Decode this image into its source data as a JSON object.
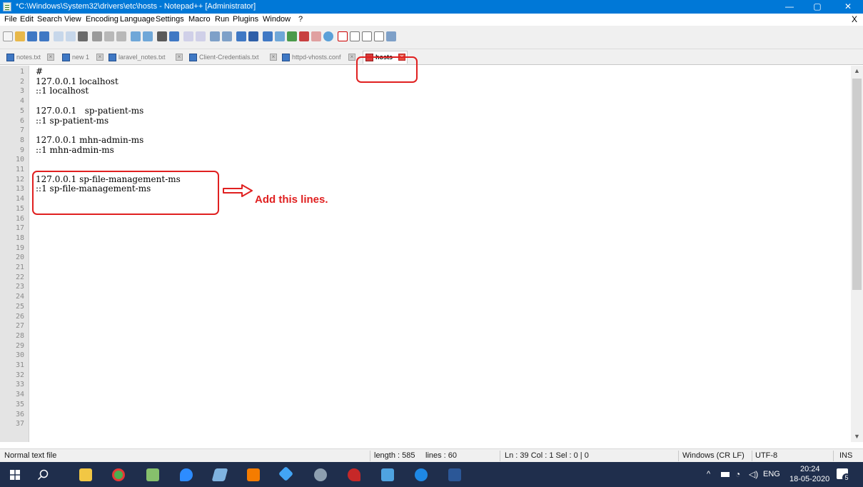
{
  "window": {
    "title": "*C:\\Windows\\System32\\drivers\\etc\\hosts - Notepad++ [Administrator]",
    "minimize": "—",
    "maximize": "▢",
    "close": "✕"
  },
  "menu": {
    "items": [
      "File",
      "Edit",
      "Search",
      "View",
      "Encoding",
      "Language",
      "Settings",
      "Macro",
      "Run",
      "Plugins",
      "Window",
      "?"
    ],
    "close_doc": "X"
  },
  "tabs": [
    {
      "label": "notes.txt",
      "active": false
    },
    {
      "label": "new 1",
      "active": false
    },
    {
      "label": "laravel_notes.txt",
      "active": false
    },
    {
      "label": "Client-Credentials.txt",
      "active": false
    },
    {
      "label": "httpd-vhosts.conf",
      "active": false
    },
    {
      "label": "hosts",
      "active": true
    }
  ],
  "editor": {
    "line_numbers": [
      "1",
      "2",
      "3",
      "4",
      "5",
      "6",
      "7",
      "8",
      "9",
      "10",
      "11",
      "12",
      "13",
      "14",
      "15",
      "16",
      "17",
      "18",
      "19",
      "20",
      "21",
      "22",
      "23",
      "24",
      "25",
      "26",
      "27",
      "28",
      "29",
      "30",
      "31",
      "32",
      "33",
      "34",
      "35",
      "36",
      "37"
    ],
    "lines": [
      "#",
      "127.0.0.1 localhost",
      "::1 localhost",
      "",
      "127.0.0.1   sp-patient-ms",
      "::1 sp-patient-ms",
      "",
      "127.0.0.1 mhn-admin-ms",
      "::1 mhn-admin-ms",
      "",
      "",
      "127.0.0.1 sp-file-management-ms",
      "::1 sp-file-management-ms"
    ]
  },
  "annotation": {
    "text": "Add this lines.",
    "color": "#e02020"
  },
  "status": {
    "file_type": "Normal text file",
    "length": "length : 585",
    "lines": "lines : 60",
    "position": "Ln : 39   Col : 1   Sel : 0 | 0",
    "eol": "Windows (CR LF)",
    "encoding": "UTF-8",
    "mode": "INS"
  },
  "taskbar": {
    "time": "20:24",
    "date": "18-05-2020",
    "lang": "ENG",
    "tray_expand": "^",
    "notification_count": "5"
  }
}
